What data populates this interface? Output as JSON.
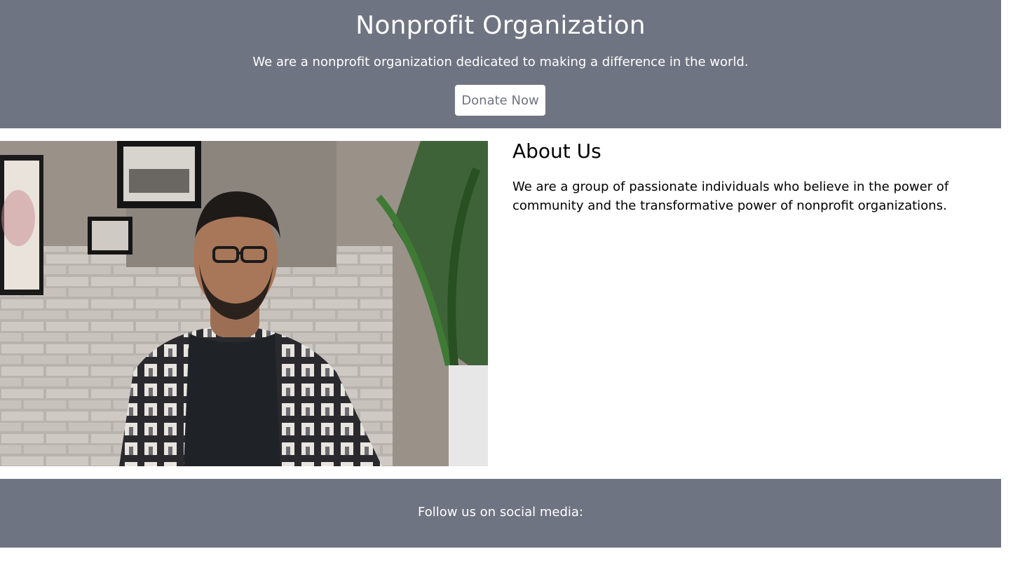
{
  "header": {
    "title": "Nonprofit Organization",
    "tagline": "We are a nonprofit organization dedicated to making a difference in the world.",
    "donate_label": "Donate Now"
  },
  "about": {
    "title": "About Us",
    "text": "We are a group of passionate individuals who believe in the power of community and the transformative power of nonprofit organizations."
  },
  "footer": {
    "text": "Follow us on social media:"
  },
  "colors": {
    "brand_gray": "#6f7482",
    "white": "#ffffff"
  }
}
